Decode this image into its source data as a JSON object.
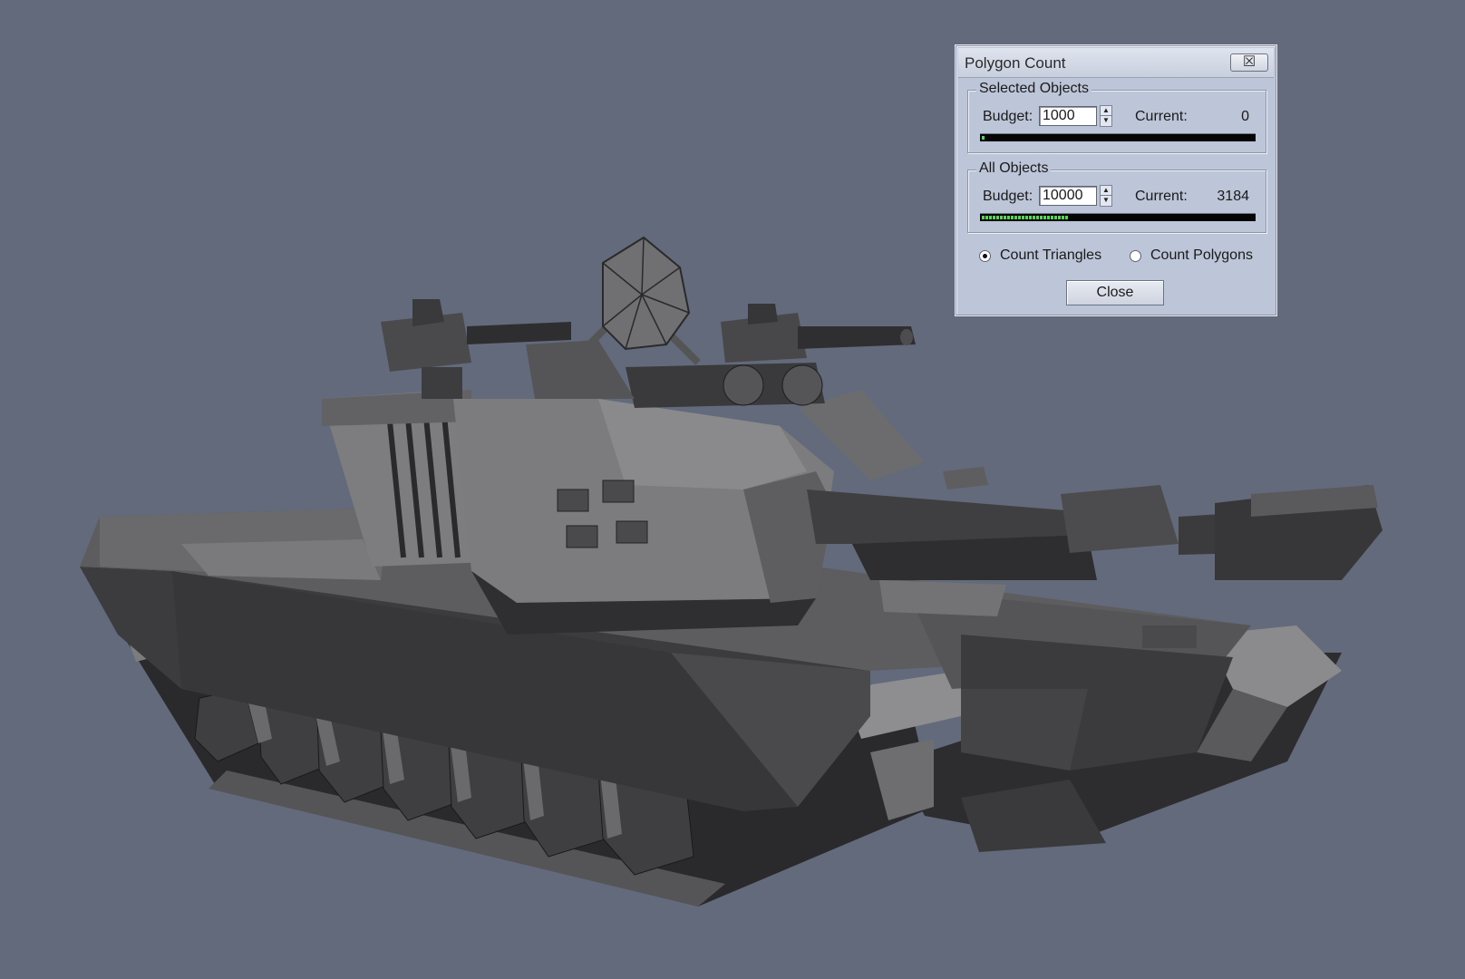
{
  "dialog": {
    "title": "Polygon Count",
    "close_icon": "☒",
    "selected": {
      "group_label": "Selected Objects",
      "budget_label": "Budget:",
      "budget_value": "1000",
      "current_label": "Current:",
      "current_value": "0",
      "progress_fraction": 0.0
    },
    "all": {
      "group_label": "All Objects",
      "budget_label": "Budget:",
      "budget_value": "10000",
      "current_label": "Current:",
      "current_value": "3184",
      "progress_fraction": 0.3184
    },
    "radio_triangles_label": "Count Triangles",
    "radio_polygons_label": "Count Polygons",
    "radio_triangles_checked": true,
    "close_label": "Close",
    "accent_progress": "#33ee33"
  },
  "viewport": {
    "background": "#626a7b",
    "model_icon": "tank-model"
  }
}
